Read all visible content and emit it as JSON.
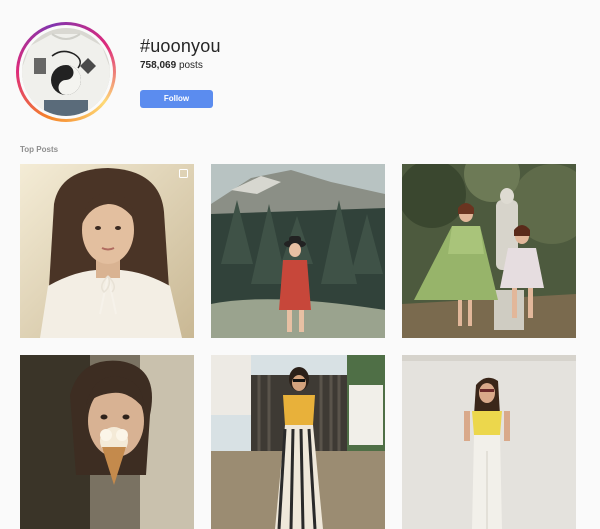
{
  "hashtag": {
    "name": "#uoonyou",
    "post_count": "758,069",
    "post_count_suffix": "posts",
    "follow_label": "Follow"
  },
  "sections": {
    "top_posts_label": "Top Posts"
  },
  "posts": [
    {
      "id": "post-1",
      "subject": "woman in white blouse portrait",
      "multiple_images_icon": "carousel-icon"
    },
    {
      "id": "post-2",
      "subject": "woman in red dress among pine trees"
    },
    {
      "id": "post-3",
      "subject": "two women beside statue in garden"
    },
    {
      "id": "post-4",
      "subject": "woman eating ice cream cone"
    },
    {
      "id": "post-5",
      "subject": "woman in yellow top by gate"
    },
    {
      "id": "post-6",
      "subject": "woman in yellow top and jeans"
    }
  ],
  "colors": {
    "follow_button": "#5b8cef",
    "background": "#fafafa",
    "ring_gradient": [
      "#f58529",
      "#dd2a7b",
      "#8134af",
      "#feda77"
    ]
  }
}
